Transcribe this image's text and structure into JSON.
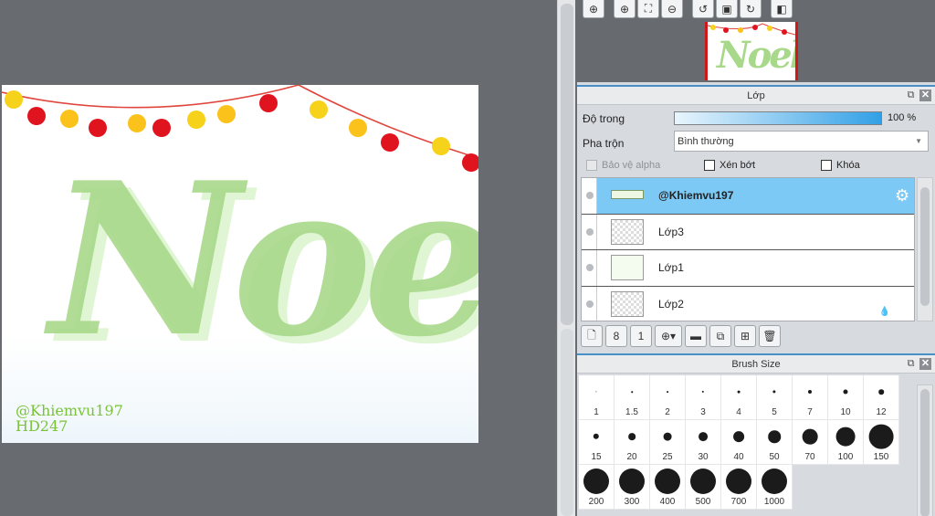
{
  "canvas": {
    "artwork_text": "Noel",
    "watermark_line1": "@Khiemvu197",
    "watermark_line2": "HD247"
  },
  "navigator": {
    "toolbar_icons": [
      "zoom-in-icon",
      "zoom-in-icon",
      "fit-screen-icon",
      "zoom-out-icon",
      "rotate-left-icon",
      "actual-size-icon",
      "rotate-right-icon",
      "flip-icon"
    ]
  },
  "layer_panel": {
    "title": "Lớp",
    "opacity_label": "Độ trong",
    "opacity_value": "100 %",
    "opacity_percent": 100,
    "blend_label": "Pha trộn",
    "blend_value": "Bình thường",
    "protect_alpha_label": "Bảo vệ alpha",
    "clipping_label": "Xén bớt",
    "lock_label": "Khóa",
    "layers": [
      {
        "name": "@Khiemvu197",
        "selected": true
      },
      {
        "name": "Lớp3",
        "selected": false
      },
      {
        "name": "Lớp1",
        "selected": false
      },
      {
        "name": "Lớp2",
        "selected": false
      }
    ]
  },
  "brush_panel": {
    "title": "Brush Size",
    "sizes": [
      "1",
      "1.5",
      "2",
      "3",
      "4",
      "5",
      "7",
      "10",
      "12",
      "15",
      "20",
      "25",
      "30",
      "40",
      "50",
      "70",
      "100",
      "150",
      "200",
      "300",
      "400",
      "500",
      "700",
      "1000"
    ]
  },
  "colors": {
    "accent": "#4a90c8",
    "selected_layer": "#7cc9f5",
    "artwork_green": "#a8d98a",
    "watermark_green": "#7bc23a"
  }
}
